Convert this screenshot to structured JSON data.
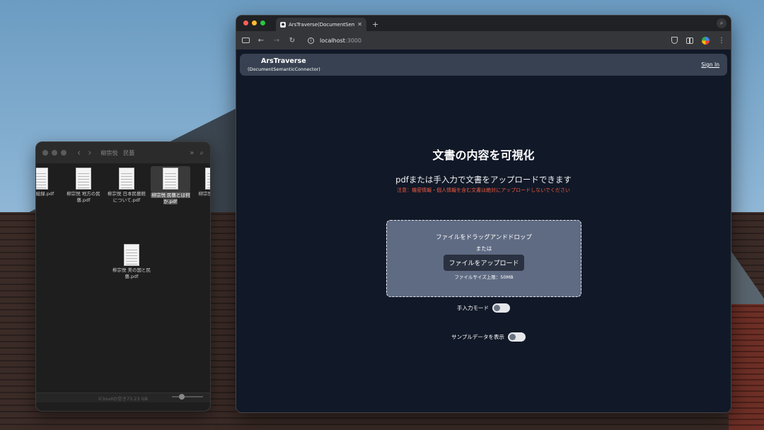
{
  "finder": {
    "title": "柳宗悦　民藝",
    "files": [
      {
        "name": "…跡絵録.pdf"
      },
      {
        "name": "柳宗悦 地方の民藝.pdf"
      },
      {
        "name": "柳宗悦 日本民藝館について.pdf"
      },
      {
        "name": "柳宗悦 民藝とは何か.pdf"
      },
      {
        "name": "柳宗悦 …書…"
      },
      {
        "name": "柳宗悦 美の国と民藝.pdf"
      }
    ],
    "status": "iCloudの空き73.23 GB"
  },
  "browser": {
    "tab_title": "ArsTraverse(DocumentSemanticConnector)",
    "url_host": "localhost",
    "url_port": ":3000"
  },
  "app": {
    "brand_name": "ArsTraverse",
    "brand_sub": "(DocumentSemanticConnector)",
    "signin": "Sign In",
    "heading": "文書の内容を可視化",
    "subtitle": "pdfまたは手入力で文書をアップロードできます",
    "warning": "注意：機密情報・個人情報を含む文書は絶対にアップロードしないでください",
    "dropzone": {
      "main": "ファイルをドラッグアンドドロップ",
      "or": "または",
      "upload_button": "ファイルをアップロード",
      "limit": "ファイルサイズ上限：50MB"
    },
    "manual_toggle_label": "手入力モード",
    "sample_toggle_label": "サンプルデータを表示"
  }
}
